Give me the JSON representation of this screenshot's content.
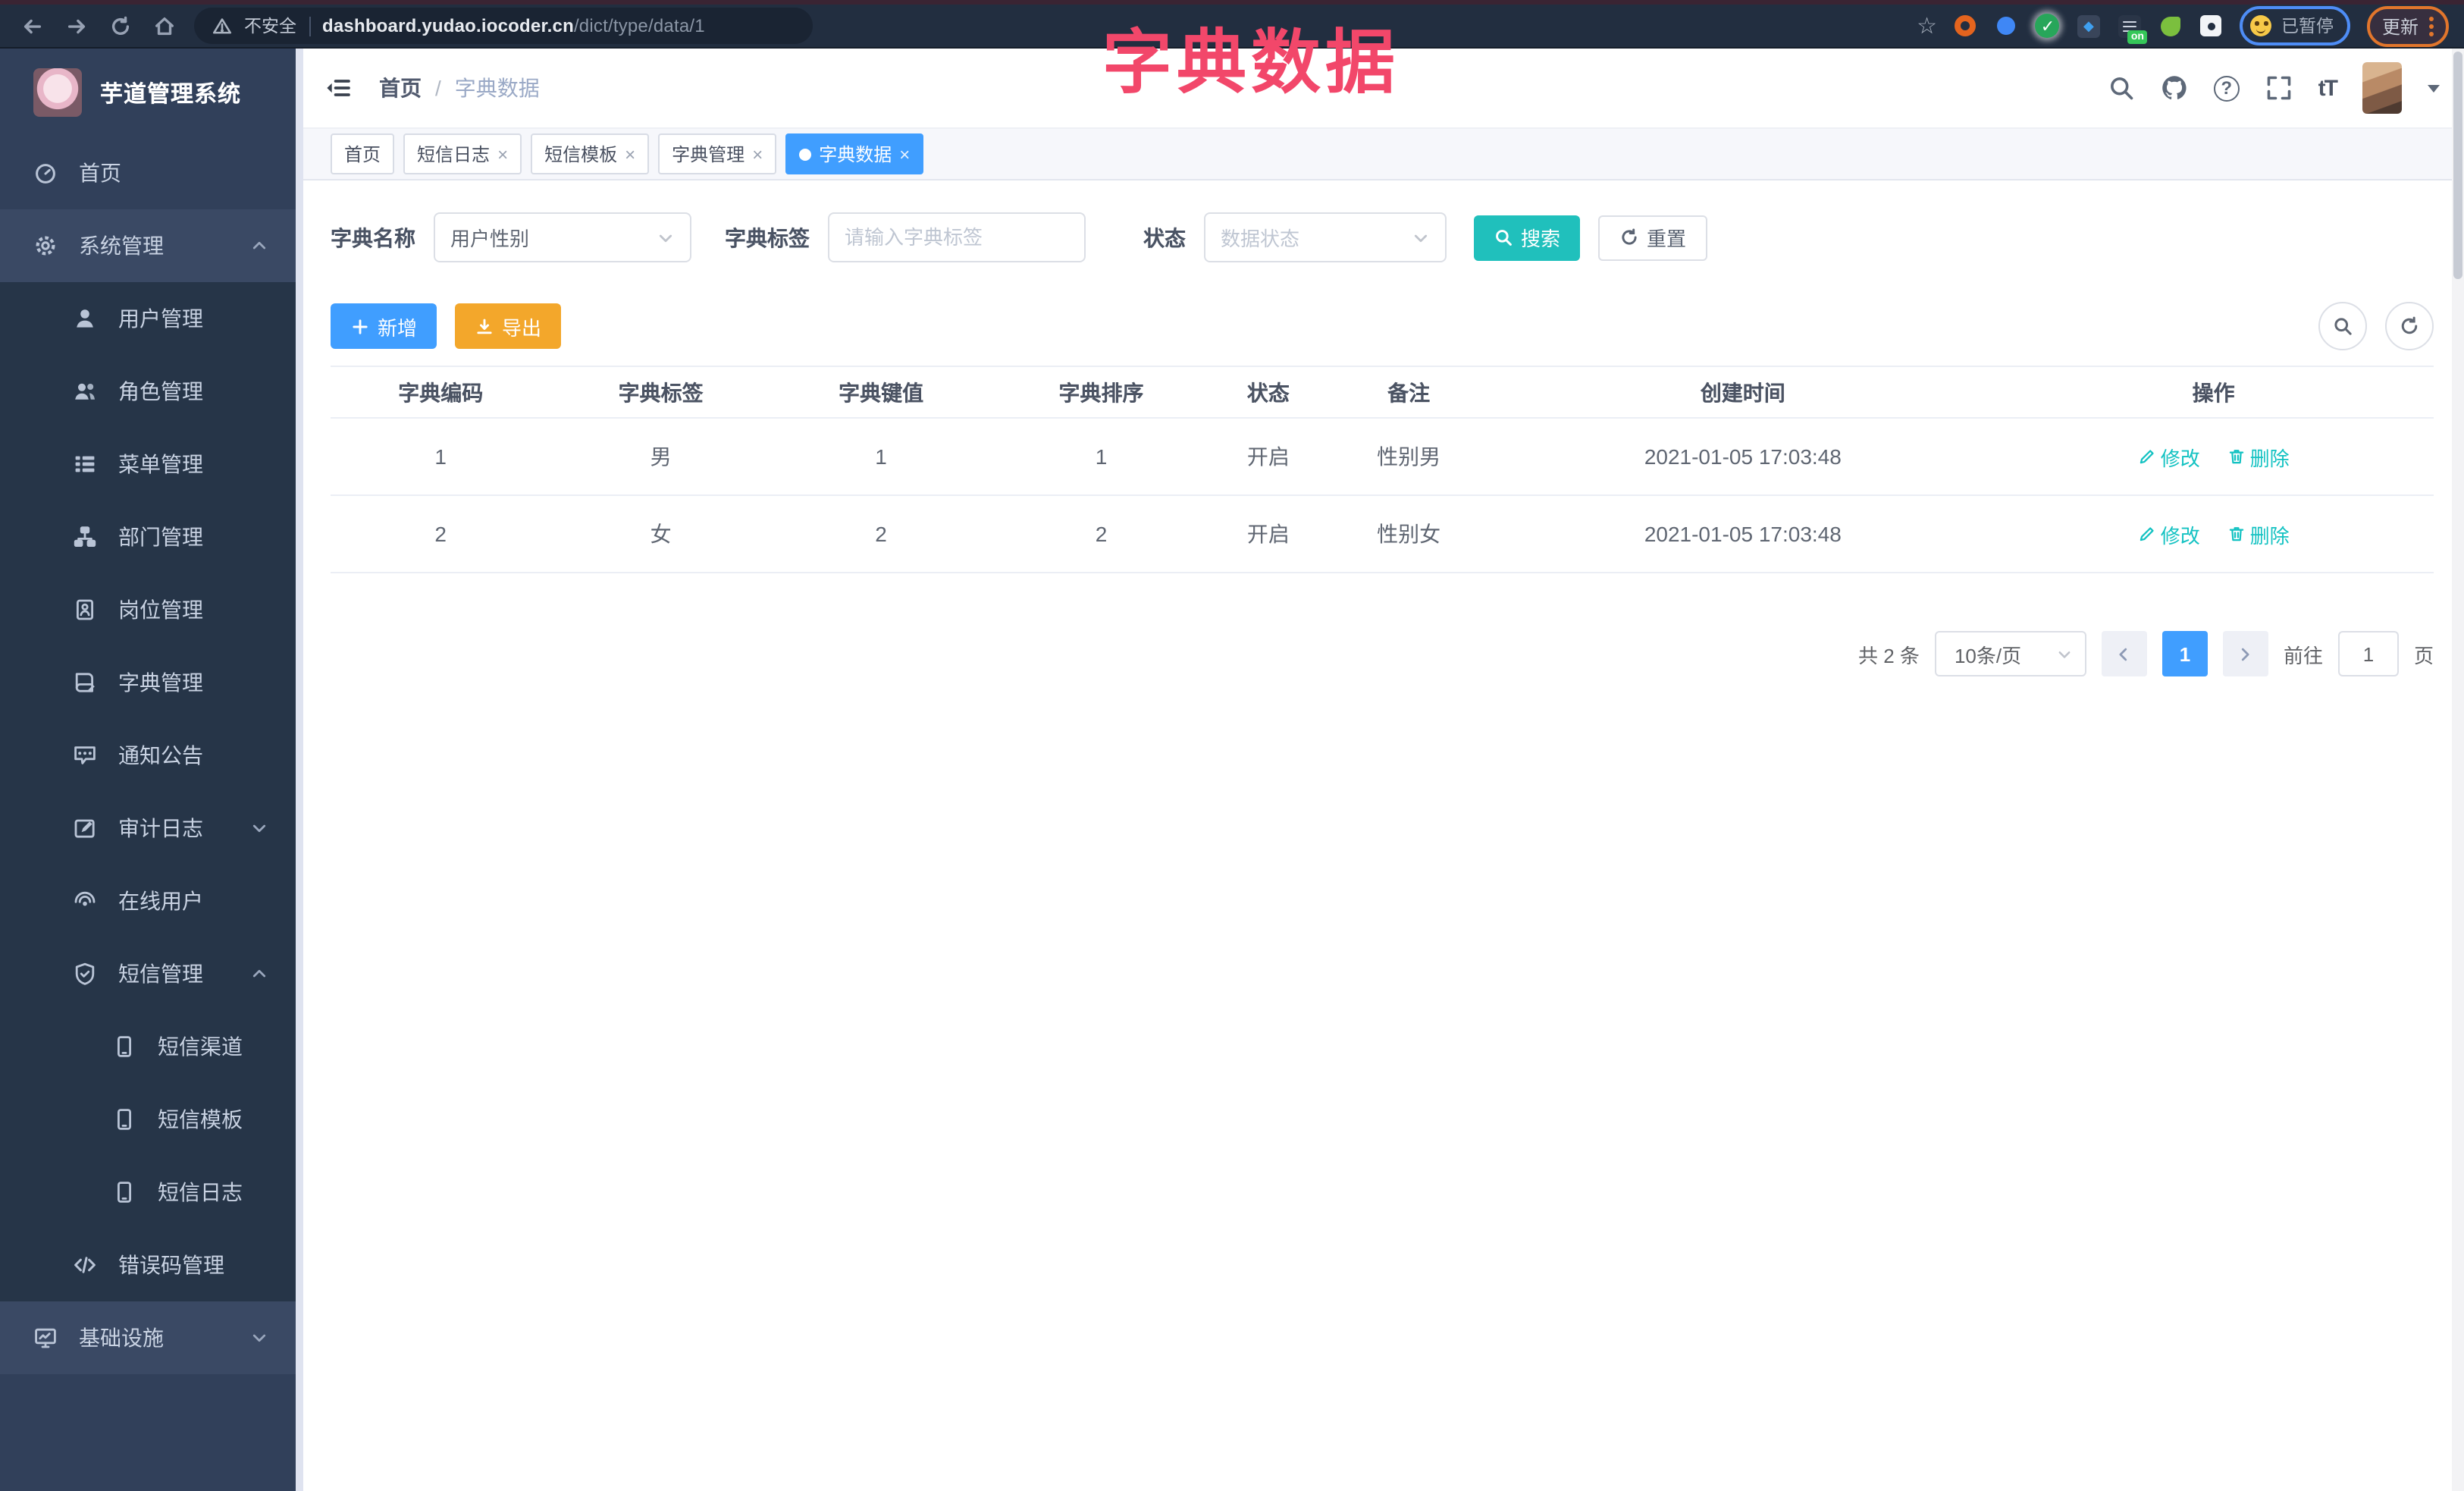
{
  "overlay": {
    "title": "字典数据"
  },
  "browser": {
    "security": "不安全",
    "url_host": "dashboard.yudao.iocoder.cn",
    "url_path": "/dict/type/data/1",
    "on_badge": "on",
    "paused_label": "已暂停",
    "update_label": "更新"
  },
  "sidebar": {
    "app_title": "芋道管理系统",
    "items": [
      {
        "label": "首页"
      },
      {
        "label": "系统管理"
      },
      {
        "label": "用户管理"
      },
      {
        "label": "角色管理"
      },
      {
        "label": "菜单管理"
      },
      {
        "label": "部门管理"
      },
      {
        "label": "岗位管理"
      },
      {
        "label": "字典管理"
      },
      {
        "label": "通知公告"
      },
      {
        "label": "审计日志"
      },
      {
        "label": "在线用户"
      },
      {
        "label": "短信管理"
      },
      {
        "label": "短信渠道"
      },
      {
        "label": "短信模板"
      },
      {
        "label": "短信日志"
      },
      {
        "label": "错误码管理"
      },
      {
        "label": "基础设施"
      }
    ]
  },
  "header": {
    "breadcrumb_home": "首页",
    "breadcrumb_sep": "/",
    "breadcrumb_current": "字典数据"
  },
  "tabs": {
    "close_glyph": "×",
    "items": [
      {
        "label": "首页",
        "closable": false,
        "active": false
      },
      {
        "label": "短信日志",
        "closable": true,
        "active": false
      },
      {
        "label": "短信模板",
        "closable": true,
        "active": false
      },
      {
        "label": "字典管理",
        "closable": true,
        "active": false
      },
      {
        "label": "字典数据",
        "closable": true,
        "active": true
      }
    ]
  },
  "filters": {
    "dict_name_label": "字典名称",
    "dict_name_value": "用户性别",
    "dict_label_label": "字典标签",
    "dict_label_placeholder": "请输入字典标签",
    "status_label": "状态",
    "status_placeholder": "数据状态",
    "search_label": "搜索",
    "reset_label": "重置"
  },
  "toolbar": {
    "add_label": "新增",
    "export_label": "导出"
  },
  "table": {
    "headers": [
      "字典编码",
      "字典标签",
      "字典键值",
      "字典排序",
      "状态",
      "备注",
      "创建时间",
      "操作"
    ],
    "rows": [
      {
        "cells": [
          "1",
          "男",
          "1",
          "1",
          "开启",
          "性别男",
          "2021-01-05 17:03:48"
        ]
      },
      {
        "cells": [
          "2",
          "女",
          "2",
          "2",
          "开启",
          "性别女",
          "2021-01-05 17:03:48"
        ]
      }
    ],
    "edit_label": "修改",
    "delete_label": "删除"
  },
  "pagination": {
    "total": "共 2 条",
    "page_size": "10条/页",
    "current_page": "1",
    "goto_label": "前往",
    "goto_value": "1",
    "page_unit": "页"
  },
  "colors": {
    "primary": "#409eff",
    "search_teal": "#20c0bc",
    "export_orange": "#f3a72b",
    "action_teal": "#13c2c2",
    "overlay_pink": "#f2476a",
    "sidebar_bg": "#31405a",
    "submenu_bg": "#263548"
  }
}
